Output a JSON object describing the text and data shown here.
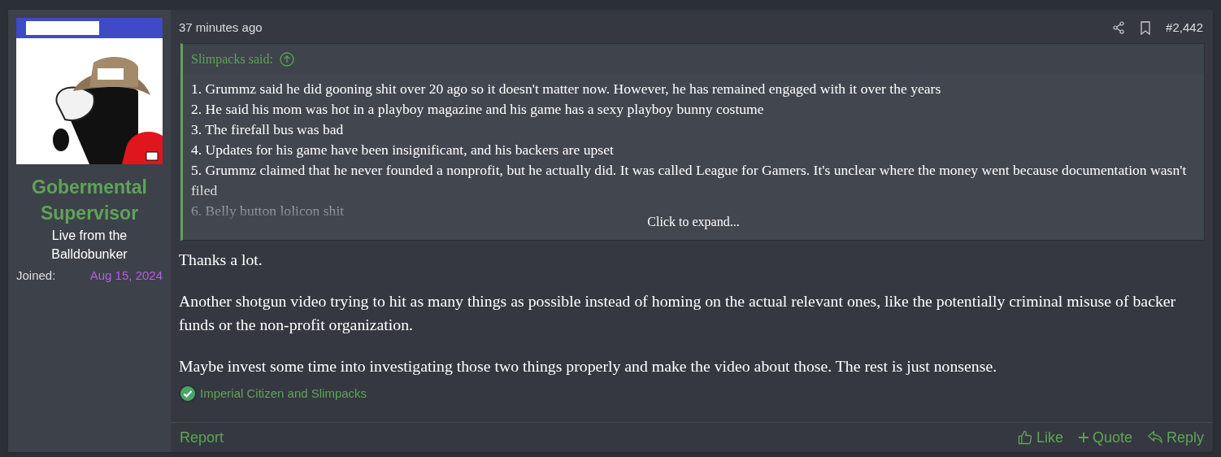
{
  "author": {
    "name": "Gobermental Supervisor",
    "title": "Live from the Balldobunker",
    "joined_label": "Joined:",
    "joined_date": "Aug 15, 2024"
  },
  "post": {
    "time": "37 minutes ago",
    "number": "#2,442",
    "quote": {
      "author_line": "Slimpacks said:",
      "lines": [
        "1. Grummz said he did gooning shit over 20 ago so it doesn't matter now. However, he has remained engaged with it over the years",
        "2. He said his mom was hot in a playboy magazine and his game has a sexy playboy bunny costume",
        "3. The firefall bus was bad",
        "4. Updates for his game have been insignificant, and his backers are upset",
        "5. Grummz claimed that he never founded a nonprofit, but he actually did. It was called League for Gamers. It's unclear where the money went because documentation wasn't filed",
        "6. Belly button lolicon shit"
      ],
      "expand": "Click to expand..."
    },
    "paragraphs": [
      "Thanks a lot.",
      "Another shotgun video trying to hit as many things as possible instead of homing on the actual relevant ones, like the potentially criminal misuse of backer funds or the non-profit organization.",
      "Maybe invest some time into investigating those two things properly and make the video about those. The rest is just nonsense."
    ],
    "reactions": "Imperial Citizen and Slimpacks",
    "footer": {
      "report": "Report",
      "actions": [
        {
          "kind": "like",
          "label": "Like"
        },
        {
          "kind": "quote",
          "label": "Quote"
        },
        {
          "kind": "reply",
          "label": "Reply"
        }
      ]
    }
  }
}
